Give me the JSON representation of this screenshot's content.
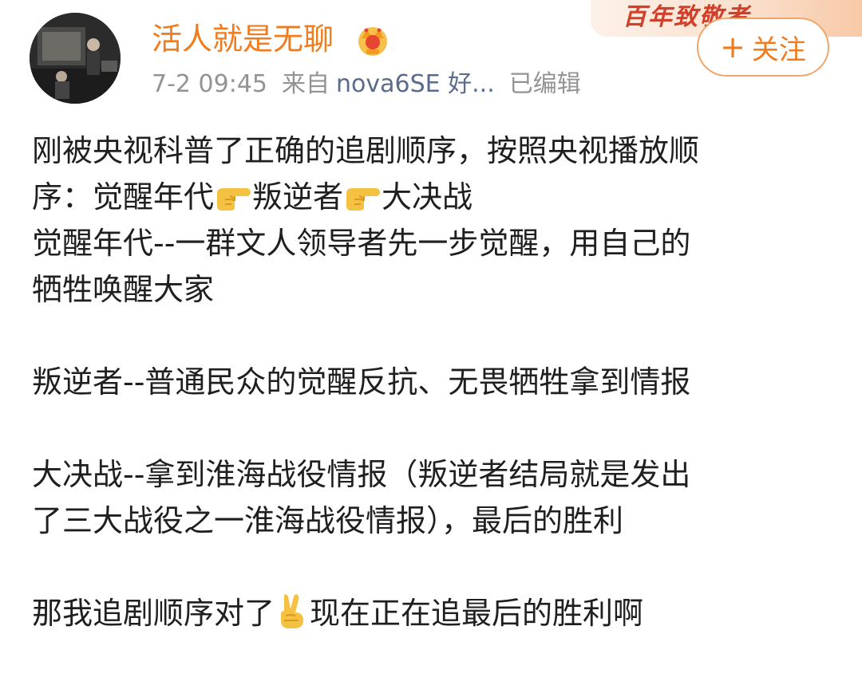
{
  "header": {
    "username": "活人就是无聊",
    "badge_icon": "vip-crown-icon",
    "time": "7-2 09:45",
    "source_prefix": "来自",
    "source_device": "nova6SE 好...",
    "edited": "已编辑",
    "banner_text": "百年致敬者",
    "follow_label": "关注",
    "follow_plus": "+",
    "colors": {
      "username": "#f07c1e",
      "follow_border": "#f2a56a",
      "banner": "#d1402a"
    }
  },
  "post": {
    "line1": "刚被央视科普了正确的追剧顺序，按照央视播放顺",
    "line2": {
      "prefix": "序：觉醒年代",
      "mid": "叛逆者",
      "end": "大决战",
      "emoji": "pointing-right-hand-icon"
    },
    "line3": "觉醒年代--一群文人领导者先一步觉醒，用自己的",
    "line4": "牺牲唤醒大家",
    "line5": "叛逆者--普通民众的觉醒反抗、无畏牺牲拿到情报",
    "line6": "大决战--拿到淮海战役情报（叛逆者结局就是发出",
    "line7": "了三大战役之一淮海战役情报），最后的胜利",
    "line8": {
      "prefix": "那我追剧顺序对了",
      "suffix": "现在正在追最后的胜利啊",
      "emoji": "victory-hand-icon"
    }
  }
}
